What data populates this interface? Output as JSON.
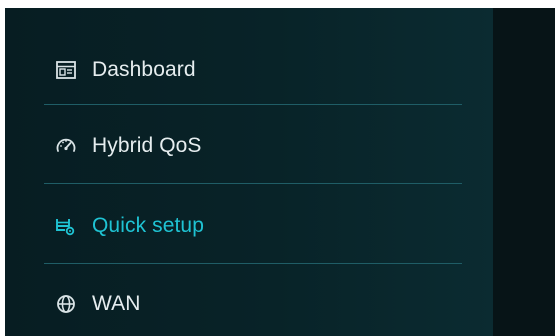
{
  "sidebar": {
    "items": [
      {
        "label": "Dashboard",
        "icon": "dashboard-icon",
        "active": false
      },
      {
        "label": "Hybrid QoS",
        "icon": "speedometer-icon",
        "active": false
      },
      {
        "label": "Quick setup",
        "icon": "quick-setup-icon",
        "active": true
      },
      {
        "label": "WAN",
        "icon": "globe-icon",
        "active": false
      }
    ]
  },
  "colors": {
    "sidebar_bg": "#082328",
    "main_bg": "#071417",
    "text": "#e6edef",
    "accent": "#1fc3d3",
    "divider": "#1f5d66"
  }
}
